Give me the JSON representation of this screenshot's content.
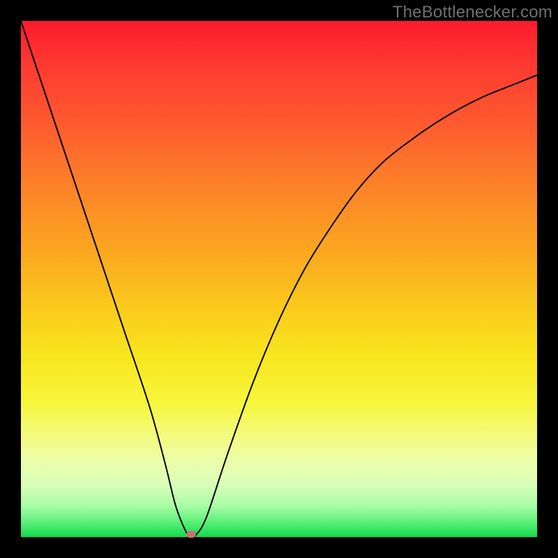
{
  "attribution": "TheBottlenecker.com",
  "chart_data": {
    "type": "line",
    "title": "",
    "xlabel": "",
    "ylabel": "",
    "xlim": [
      0,
      100
    ],
    "ylim": [
      0,
      100
    ],
    "series": [
      {
        "name": "bottleneck-curve",
        "x": [
          0,
          5,
          10,
          15,
          20,
          25,
          28,
          30,
          32,
          33,
          34,
          36,
          40,
          45,
          50,
          55,
          60,
          65,
          70,
          75,
          80,
          85,
          90,
          95,
          100
        ],
        "y": [
          100,
          85,
          70,
          55,
          40,
          25,
          14,
          6,
          1,
          0,
          0.5,
          4,
          16,
          30,
          42,
          52,
          60,
          67,
          72.5,
          76.5,
          80,
          83,
          85.5,
          87.5,
          89.5
        ]
      }
    ],
    "marker": {
      "x": 33,
      "y": 0.5,
      "color": "#c9716a"
    },
    "background_gradient": {
      "top": "#fd1a2c",
      "mid": "#f8e61e",
      "bottom": "#0edb4b"
    }
  }
}
